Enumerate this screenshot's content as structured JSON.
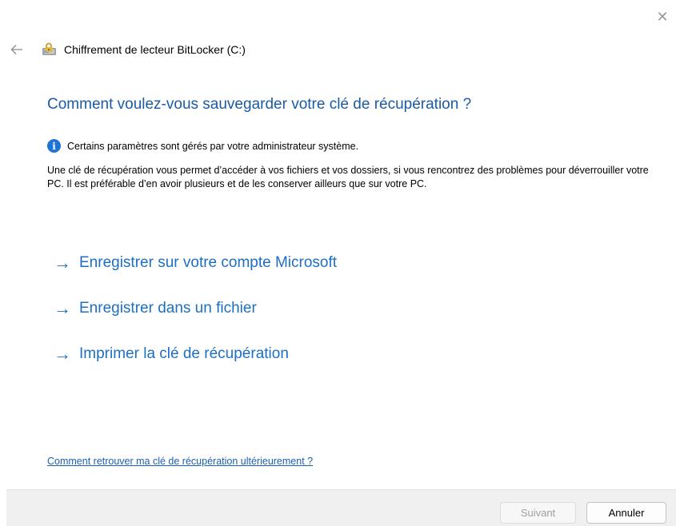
{
  "window": {
    "title": "Chiffrement de lecteur BitLocker (C:)",
    "close_glyph": "✕",
    "back_glyph": "←"
  },
  "heading": "Comment voulez-vous sauvegarder votre clé de récupération ?",
  "info": {
    "icon_glyph": "i",
    "text": "Certains paramètres sont gérés par votre administrateur système."
  },
  "description": "Une clé de récupération vous permet d’accéder à vos fichiers et vos dossiers, si vous rencontrez des problèmes pour déverrouiller votre PC. Il est préférable d’en avoir plusieurs et de les conserver ailleurs que sur votre PC.",
  "options": [
    {
      "label": "Enregistrer sur votre compte Microsoft",
      "arrow": "→"
    },
    {
      "label": "Enregistrer dans un fichier",
      "arrow": "→"
    },
    {
      "label": "Imprimer la clé de récupération",
      "arrow": "→"
    }
  ],
  "help_link": "Comment retrouver ma clé de récupération ultérieurement ?",
  "footer": {
    "next_label": "Suivant",
    "cancel_label": "Annuler"
  },
  "icons": {
    "close": "close-icon",
    "back": "back-arrow-icon",
    "app": "bitlocker-drive-icon",
    "info": "info-icon",
    "option": "arrow-right-icon"
  },
  "colors": {
    "heading": "#1c5aa6",
    "link": "#1d6fc4",
    "info_icon": "#1e74d6",
    "footer_bg": "#f0f0f0"
  }
}
